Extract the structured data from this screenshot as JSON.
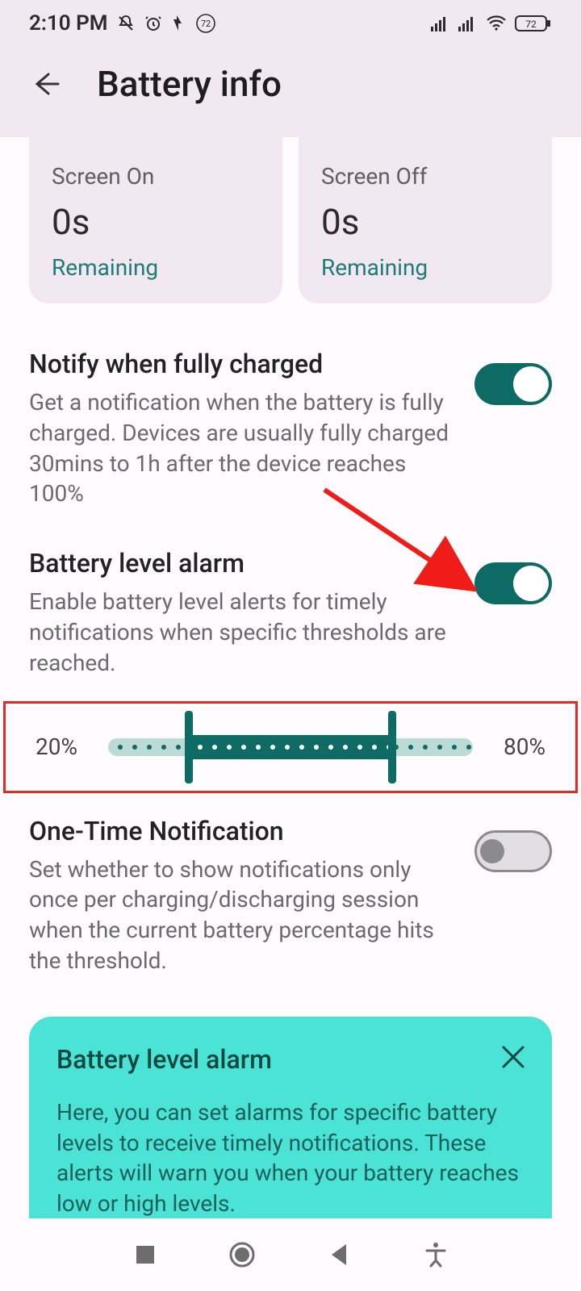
{
  "statusbar": {
    "time": "2:10 PM",
    "battery_percent": "72"
  },
  "header": {
    "title": "Battery info"
  },
  "cards": {
    "screen_on": {
      "label": "Screen On",
      "value": "0s",
      "sub": "Remaining"
    },
    "screen_off": {
      "label": "Screen Off",
      "value": "0s",
      "sub": "Remaining"
    }
  },
  "settings": {
    "notify_full": {
      "title": "Notify when fully charged",
      "desc": "Get a notification when the battery is fully charged. Devices are usually fully charged 30mins to 1h after the device reaches 100%"
    },
    "level_alarm": {
      "title": "Battery level alarm",
      "desc": "Enable battery level alerts for timely notifications when specific thresholds are reached."
    },
    "slider": {
      "low": "20%",
      "high": "80%"
    },
    "one_time": {
      "title": "One-Time Notification",
      "desc": "Set whether to show notifications only once per charging/discharging session when the current battery percentage hits the threshold."
    }
  },
  "infobox": {
    "title": "Battery level alarm",
    "body": "Here, you can set alarms for specific battery levels to receive timely notifications. These alerts will warn you when your battery reaches low or high levels.\nWhile this feature doesn't directly alter your"
  }
}
